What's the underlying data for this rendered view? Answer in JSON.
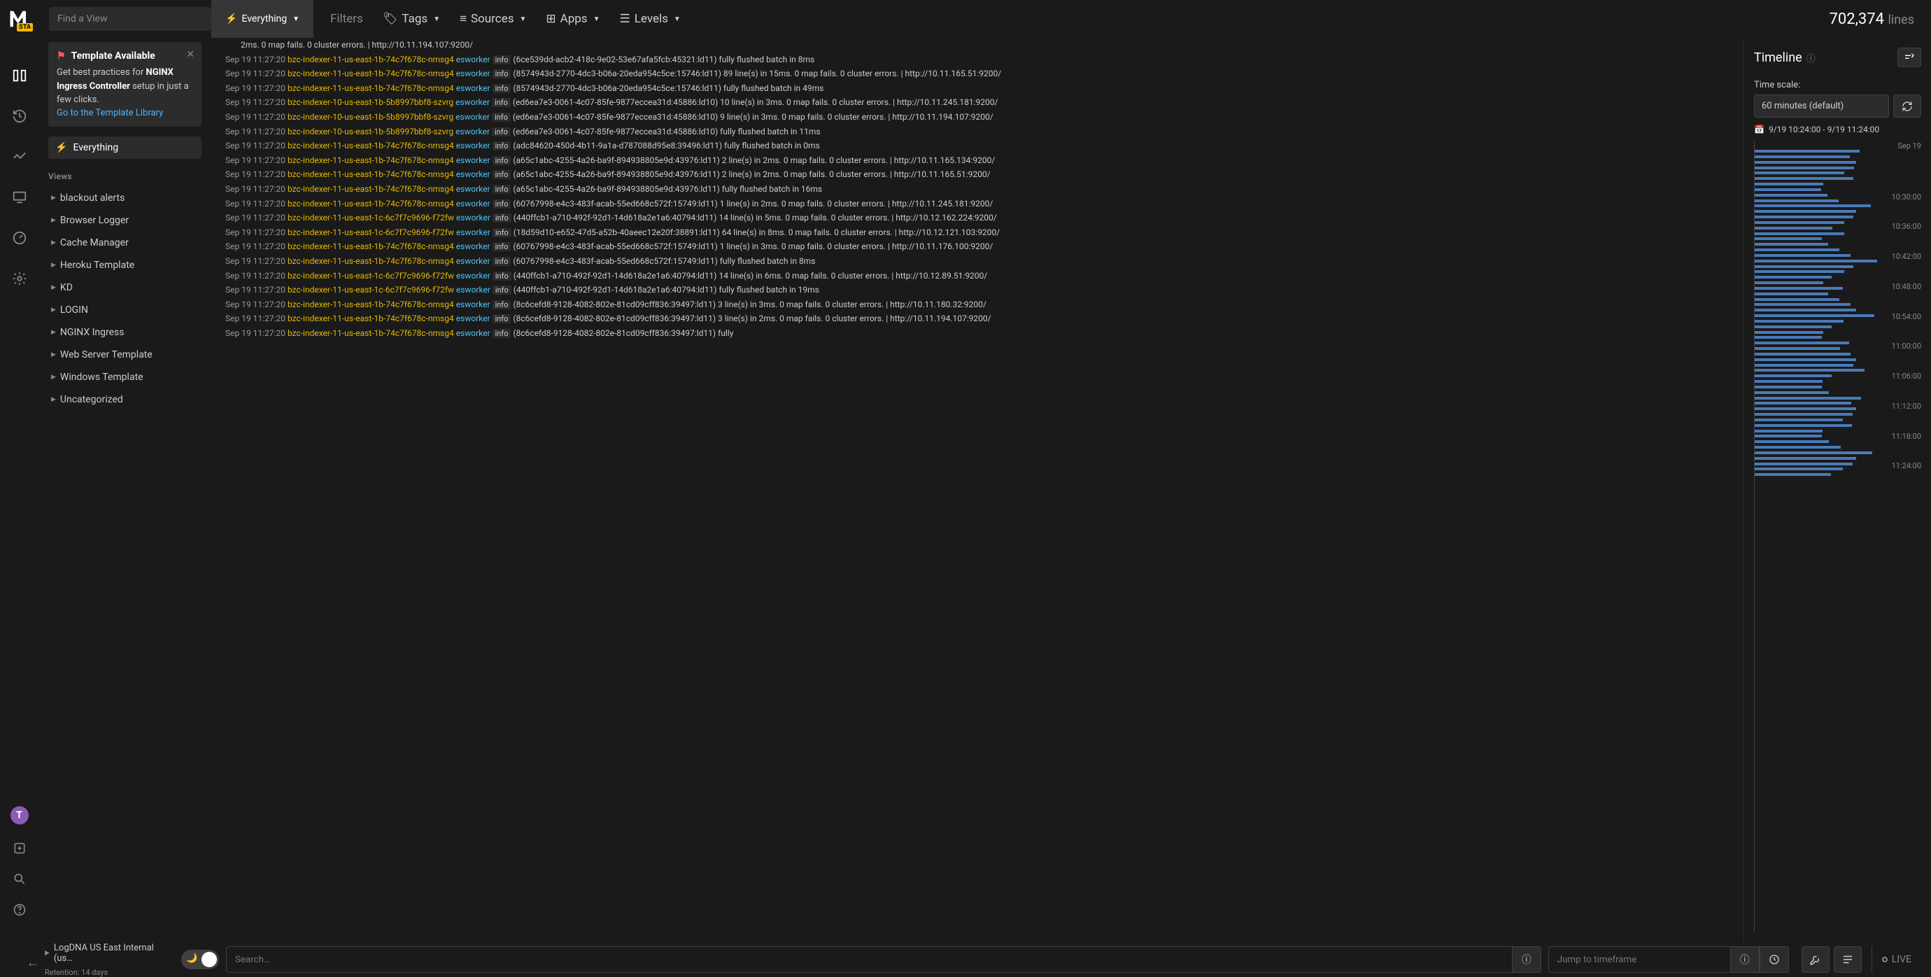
{
  "topbar": {
    "logo_badge": "STA",
    "find_placeholder": "Find a View",
    "active_tab": "Everything",
    "filters_label": "Filters",
    "menus": [
      {
        "label": "Tags",
        "icon": "tag"
      },
      {
        "label": "Sources",
        "icon": "server"
      },
      {
        "label": "Apps",
        "icon": "grid"
      },
      {
        "label": "Levels",
        "icon": "layers"
      }
    ],
    "line_count_num": "702,374",
    "line_count_label": "lines"
  },
  "sidebar": {
    "template_title": "Template Available",
    "template_desc_pre": "Get best practices for ",
    "template_desc_bold": "NGINX Ingress Controller",
    "template_desc_post": " setup in just a few clicks.",
    "template_link": "Go to the Template Library",
    "everything_label": "Everything",
    "views_label": "Views",
    "view_items": [
      "blackout alerts",
      "Browser Logger",
      "Cache Manager",
      "Heroku Template",
      "KD",
      "LOGIN",
      "NGINX Ingress",
      "Web Server Template",
      "Windows Template",
      "Uncategorized"
    ]
  },
  "nav": {
    "avatar_letter": "T"
  },
  "logs": [
    {
      "cont": "2ms. 0 map fails. 0 cluster errors. | http://10.11.194.107:9200/"
    },
    {
      "ts": "Sep 19 11:27:20",
      "host": "bzc-indexer-11-us-east-1b-74c7f678c-nmsg4",
      "app": "esworker",
      "lvl": "info",
      "msg": "(6ce539dd-acb2-418c-9e02-53e67afa5fcb:45321:ld11) fully flushed batch in 8ms"
    },
    {
      "ts": "Sep 19 11:27:20",
      "host": "bzc-indexer-11-us-east-1b-74c7f678c-nmsg4",
      "app": "esworker",
      "lvl": "info",
      "msg": "(8574943d-2770-4dc3-b06a-20eda954c5ce:15746:ld11) 89 line(s) in 15ms. 0 map fails. 0 cluster errors. | http://10.11.165.51:9200/"
    },
    {
      "ts": "Sep 19 11:27:20",
      "host": "bzc-indexer-11-us-east-1b-74c7f678c-nmsg4",
      "app": "esworker",
      "lvl": "info",
      "msg": "(8574943d-2770-4dc3-b06a-20eda954c5ce:15746:ld11) fully flushed batch in 49ms"
    },
    {
      "ts": "Sep 19 11:27:20",
      "host": "bzc-indexer-10-us-east-1b-5b8997bbf8-szvrg",
      "app": "esworker",
      "lvl": "info",
      "msg": "(ed6ea7e3-0061-4c07-85fe-9877eccea31d:45886:ld10) 10 line(s) in 3ms. 0 map fails. 0 cluster errors. | http://10.11.245.181:9200/"
    },
    {
      "ts": "Sep 19 11:27:20",
      "host": "bzc-indexer-10-us-east-1b-5b8997bbf8-szvrg",
      "app": "esworker",
      "lvl": "info",
      "msg": "(ed6ea7e3-0061-4c07-85fe-9877eccea31d:45886:ld10) 9 line(s) in 3ms. 0 map fails. 0 cluster errors. | http://10.11.194.107:9200/"
    },
    {
      "ts": "Sep 19 11:27:20",
      "host": "bzc-indexer-10-us-east-1b-5b8997bbf8-szvrg",
      "app": "esworker",
      "lvl": "info",
      "msg": "(ed6ea7e3-0061-4c07-85fe-9877eccea31d:45886:ld10) fully flushed batch in 11ms"
    },
    {
      "ts": "Sep 19 11:27:20",
      "host": "bzc-indexer-11-us-east-1b-74c7f678c-nmsg4",
      "app": "esworker",
      "lvl": "info",
      "msg": "(adc84620-450d-4b11-9a1a-d787088d95e8:39496:ld11) fully flushed batch in 0ms"
    },
    {
      "ts": "Sep 19 11:27:20",
      "host": "bzc-indexer-11-us-east-1b-74c7f678c-nmsg4",
      "app": "esworker",
      "lvl": "info",
      "msg": "(a65c1abc-4255-4a26-ba9f-894938805e9d:43976:ld11) 2 line(s) in 2ms. 0 map fails. 0 cluster errors. | http://10.11.165.134:9200/"
    },
    {
      "ts": "Sep 19 11:27:20",
      "host": "bzc-indexer-11-us-east-1b-74c7f678c-nmsg4",
      "app": "esworker",
      "lvl": "info",
      "msg": "(a65c1abc-4255-4a26-ba9f-894938805e9d:43976:ld11) 2 line(s) in 2ms. 0 map fails. 0 cluster errors. | http://10.11.165.51:9200/"
    },
    {
      "ts": "Sep 19 11:27:20",
      "host": "bzc-indexer-11-us-east-1b-74c7f678c-nmsg4",
      "app": "esworker",
      "lvl": "info",
      "msg": "(a65c1abc-4255-4a26-ba9f-894938805e9d:43976:ld11) fully flushed batch in 16ms"
    },
    {
      "ts": "Sep 19 11:27:20",
      "host": "bzc-indexer-11-us-east-1b-74c7f678c-nmsg4",
      "app": "esworker",
      "lvl": "info",
      "msg": "(60767998-e4c3-483f-acab-55ed668c572f:15749:ld11) 1 line(s) in 2ms. 0 map fails. 0 cluster errors. | http://10.11.245.181:9200/"
    },
    {
      "ts": "Sep 19 11:27:20",
      "host": "bzc-indexer-11-us-east-1c-6c7f7c9696-f72fw",
      "app": "esworker",
      "lvl": "info",
      "msg": "(440ffcb1-a710-492f-92d1-14d618a2e1a6:40794:ld11) 14 line(s) in 5ms. 0 map fails. 0 cluster errors. | http://10.12.162.224:9200/"
    },
    {
      "ts": "Sep 19 11:27:20",
      "host": "bzc-indexer-11-us-east-1c-6c7f7c9696-f72fw",
      "app": "esworker",
      "lvl": "info",
      "msg": "(18d59d10-e652-47d5-a52b-40aeec12e20f:38891:ld11) 64 line(s) in 8ms. 0 map fails. 0 cluster errors. | http://10.12.121.103:9200/"
    },
    {
      "ts": "Sep 19 11:27:20",
      "host": "bzc-indexer-11-us-east-1b-74c7f678c-nmsg4",
      "app": "esworker",
      "lvl": "info",
      "msg": "(60767998-e4c3-483f-acab-55ed668c572f:15749:ld11) 1 line(s) in 3ms. 0 map fails. 0 cluster errors. | http://10.11.176.100:9200/"
    },
    {
      "ts": "Sep 19 11:27:20",
      "host": "bzc-indexer-11-us-east-1b-74c7f678c-nmsg4",
      "app": "esworker",
      "lvl": "info",
      "msg": "(60767998-e4c3-483f-acab-55ed668c572f:15749:ld11) fully flushed batch in 8ms"
    },
    {
      "ts": "Sep 19 11:27:20",
      "host": "bzc-indexer-11-us-east-1c-6c7f7c9696-f72fw",
      "app": "esworker",
      "lvl": "info",
      "msg": "(440ffcb1-a710-492f-92d1-14d618a2e1a6:40794:ld11) 14 line(s) in 6ms. 0 map fails. 0 cluster errors. | http://10.12.89.51:9200/"
    },
    {
      "ts": "Sep 19 11:27:20",
      "host": "bzc-indexer-11-us-east-1c-6c7f7c9696-f72fw",
      "app": "esworker",
      "lvl": "info",
      "msg": "(440ffcb1-a710-492f-92d1-14d618a2e1a6:40794:ld11) fully flushed batch in 19ms"
    },
    {
      "ts": "Sep 19 11:27:20",
      "host": "bzc-indexer-11-us-east-1b-74c7f678c-nmsg4",
      "app": "esworker",
      "lvl": "info",
      "msg": "(8c6cefd8-9128-4082-802e-81cd09cff836:39497:ld11) 3 line(s) in 3ms. 0 map fails. 0 cluster errors. | http://10.11.180.32:9200/"
    },
    {
      "ts": "Sep 19 11:27:20",
      "host": "bzc-indexer-11-us-east-1b-74c7f678c-nmsg4",
      "app": "esworker",
      "lvl": "info",
      "msg": "(8c6cefd8-9128-4082-802e-81cd09cff836:39497:ld11) 3 line(s) in 2ms. 0 map fails. 0 cluster errors. | http://10.11.194.107:9200/"
    },
    {
      "ts": "Sep 19 11:27:20",
      "host": "bzc-indexer-11-us-east-1b-74c7f678c-nmsg4",
      "app": "esworker",
      "lvl": "info",
      "msg": "(8c6cefd8-9128-4082-802e-81cd09cff836:39497:ld11) fully"
    }
  ],
  "timeline": {
    "title": "Timeline",
    "scale_label": "Time scale:",
    "scale_value": "60 minutes (default)",
    "range": "9/19 10:24:00 - 9/19 11:24:00",
    "date_label": "Sep 19",
    "ticks": [
      "10:30:00",
      "10:36:00",
      "10:42:00",
      "10:48:00",
      "10:54:00",
      "11:00:00",
      "11:06:00",
      "11:12:00",
      "11:18:00",
      "11:24:00"
    ]
  },
  "bottombar": {
    "source_name": "LogDNA US East Internal (us…",
    "retention": "Retention: 14 days",
    "search_placeholder": "Search…",
    "jump_placeholder": "Jump to timeframe",
    "live_label": "LIVE"
  }
}
